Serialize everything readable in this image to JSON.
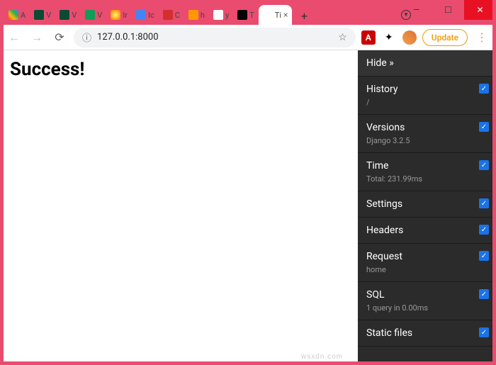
{
  "window": {
    "minimize": "—",
    "maximize": "☐",
    "close": "✕"
  },
  "tabs": [
    {
      "title": "A",
      "favicon_bg": "linear-gradient(45deg,#ea4335,#fbbc05,#34a853,#4285f4)"
    },
    {
      "title": "V",
      "favicon_bg": "#0c4b33"
    },
    {
      "title": "V",
      "favicon_bg": "#0c4b33"
    },
    {
      "title": "V",
      "favicon_bg": "#0f9d58"
    },
    {
      "title": "Ir",
      "favicon_bg": "radial-gradient(circle,#ff6,#f60)"
    },
    {
      "title": "Ic",
      "favicon_bg": "#4285f4"
    },
    {
      "title": "C",
      "favicon_bg": "#d32f2f"
    },
    {
      "title": "h",
      "favicon_bg": "#ff9800"
    },
    {
      "title": "y",
      "favicon_bg": "#fff"
    },
    {
      "title": "T",
      "favicon_bg": "#000"
    },
    {
      "title": "Ti",
      "favicon_bg": "#fff",
      "active": true
    }
  ],
  "newtab": "+",
  "chevron": "▼",
  "toolbar": {
    "back": "←",
    "forward": "→",
    "reload": "⟳",
    "info": "ⓘ",
    "url": "127.0.0.1:8000",
    "star": "☆",
    "adobe": "A",
    "puzzle": "✦",
    "update": "Update",
    "menu": "⋮"
  },
  "page": {
    "heading": "Success!"
  },
  "djdt": {
    "hide": "Hide",
    "panels": [
      {
        "title": "History",
        "sub": "/"
      },
      {
        "title": "Versions",
        "sub": "Django 3.2.5"
      },
      {
        "title": "Time",
        "sub": "Total: 231.99ms"
      },
      {
        "title": "Settings",
        "sub": ""
      },
      {
        "title": "Headers",
        "sub": ""
      },
      {
        "title": "Request",
        "sub": "home"
      },
      {
        "title": "SQL",
        "sub": "1 query in 0.00ms"
      },
      {
        "title": "Static files",
        "sub": ""
      }
    ],
    "check": "✓"
  },
  "watermark": "wsxdn.com"
}
